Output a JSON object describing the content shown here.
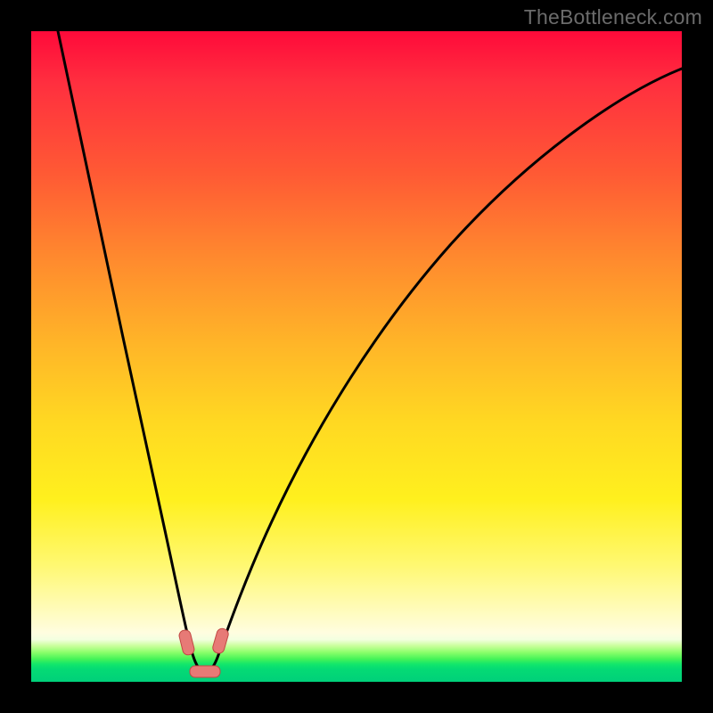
{
  "watermark": "TheBottleneck.com",
  "colors": {
    "frame": "#000000",
    "gradient_top": "#ff0a3a",
    "gradient_mid": "#ffd822",
    "gradient_bottom": "#00d07a",
    "curve": "#000000",
    "marker_fill": "#e77a76",
    "marker_stroke": "#c24844"
  },
  "chart_data": {
    "type": "line",
    "title": "",
    "xlabel": "",
    "ylabel": "",
    "ylim": [
      0,
      100
    ],
    "xlim": [
      0,
      100
    ],
    "series": [
      {
        "name": "bottleneck-curve",
        "x": [
          4,
          6,
          8,
          10,
          12,
          14,
          16,
          18,
          20,
          22,
          24,
          25,
          26,
          27,
          28,
          30,
          32,
          35,
          40,
          45,
          50,
          55,
          60,
          65,
          70,
          75,
          80,
          85,
          90,
          95,
          100
        ],
        "y": [
          100,
          90,
          79,
          68,
          57,
          47,
          37,
          28,
          19,
          11,
          5,
          2,
          1,
          1,
          2,
          5,
          10,
          17,
          28,
          37,
          45,
          52,
          58,
          64,
          69,
          73,
          77,
          80,
          83,
          86,
          88
        ]
      }
    ],
    "markers": [
      {
        "name": "left-edge-marker",
        "x": 24.0,
        "y": 5.0
      },
      {
        "name": "right-edge-marker",
        "x": 28.2,
        "y": 5.0
      },
      {
        "name": "bottom-marker",
        "x": 26.0,
        "y": 1.2
      }
    ],
    "minimum_at_x": 26,
    "green_band_y": [
      0,
      3
    ]
  }
}
